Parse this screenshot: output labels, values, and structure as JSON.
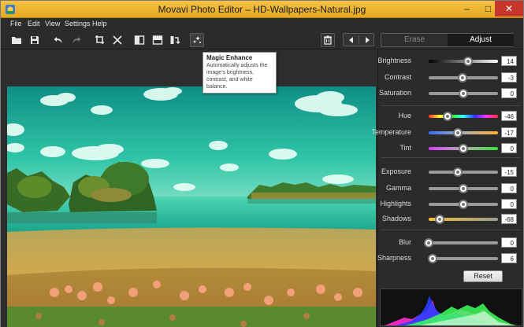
{
  "window": {
    "title": "Movavi Photo Editor – HD-Wallpapers-Natural.jpg",
    "minimize_label": "–",
    "maximize_label": "□",
    "close_label": "✕"
  },
  "menu": [
    "File",
    "Edit",
    "View",
    "Settings",
    "Help"
  ],
  "toolbar": {
    "icons": [
      "open-folder-icon",
      "save-icon",
      "undo-icon",
      "redo-icon",
      "crop-icon",
      "close-x-icon",
      "compare-split-vertical-icon",
      "compare-split-horizontal-icon",
      "rotate-flip-icon",
      "magic-enhance-icon",
      "delete-icon",
      "previous-icon",
      "next-icon"
    ]
  },
  "tabs": {
    "erase": "Erase",
    "adjust": "Adjust",
    "active": "Adjust"
  },
  "tooltip": {
    "title": "Magic Enhance",
    "body": "Automatically adjusts the image's brightness, contrast, and white balance."
  },
  "adjustments": [
    {
      "label": "Brightness",
      "value": "14",
      "level": 0.57,
      "track": "brightness"
    },
    {
      "label": "Contrast",
      "value": "-3",
      "level": 0.485,
      "track": "plain"
    },
    {
      "label": "Saturation",
      "value": "0",
      "level": 0.5,
      "track": "plain"
    },
    {
      "label": "Hue",
      "value": "-46",
      "level": 0.27,
      "track": "hue"
    },
    {
      "label": "Temperature",
      "value": "-17",
      "level": 0.415,
      "track": "temperature"
    },
    {
      "label": "Tint",
      "value": "0",
      "level": 0.5,
      "track": "tint"
    },
    {
      "label": "Exposure",
      "value": "-15",
      "level": 0.425,
      "track": "plain"
    },
    {
      "label": "Gamma",
      "value": "0",
      "level": 0.5,
      "track": "plain"
    },
    {
      "label": "Highlights",
      "value": "0",
      "level": 0.5,
      "track": "plain"
    },
    {
      "label": "Shadows",
      "value": "-68",
      "level": 0.16,
      "track": "shadows"
    },
    {
      "label": "Blur",
      "value": "0",
      "level": 0.0,
      "track": "plain"
    },
    {
      "label": "Sharpness",
      "value": "6",
      "level": 0.06,
      "track": "plain"
    }
  ],
  "reset_label": "Reset",
  "colors": {
    "titlebar": "#eab12a",
    "close_button": "#c7362c",
    "panel": "#2b2b2b",
    "sky": "#1fb39a",
    "field": "#c9a24a"
  }
}
